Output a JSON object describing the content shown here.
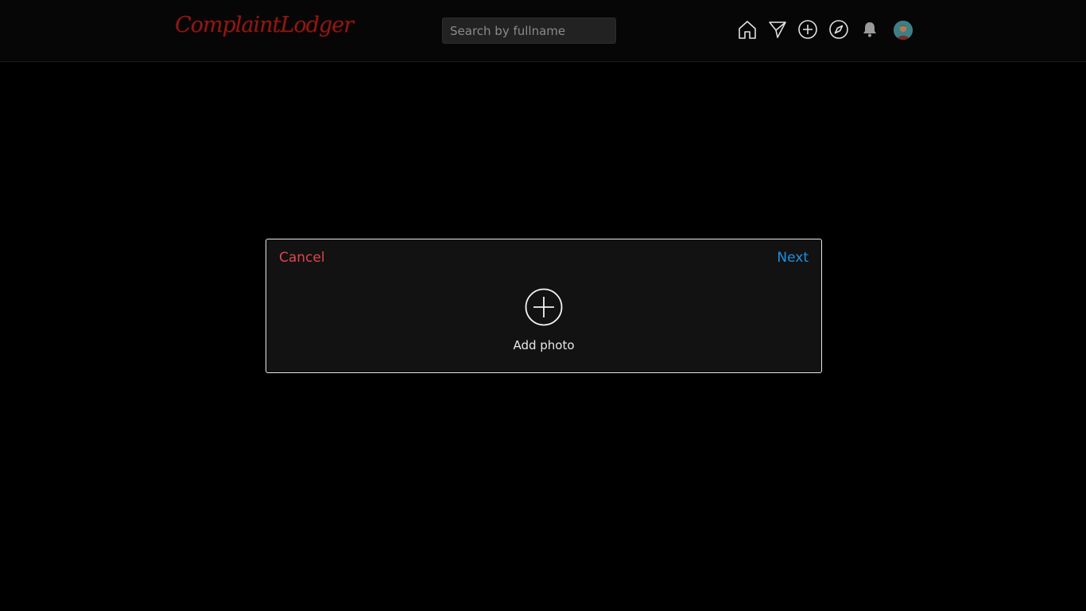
{
  "header": {
    "logo_text": "ComplaintLodger",
    "search": {
      "placeholder": "Search by fullname",
      "value": ""
    },
    "nav_icons": [
      "home-icon",
      "send-icon",
      "add-post-icon",
      "explore-icon",
      "notifications-icon",
      "profile-avatar"
    ]
  },
  "modal": {
    "cancel_label": "Cancel",
    "next_label": "Next",
    "add_photo_label": "Add photo"
  },
  "colors": {
    "background": "#000000",
    "topbar": "#060606",
    "logo": "#8a1a14",
    "cancel": "#e0454c",
    "next": "#1e90e6",
    "modal_bg": "#121212",
    "modal_border": "#e6e6e6"
  }
}
